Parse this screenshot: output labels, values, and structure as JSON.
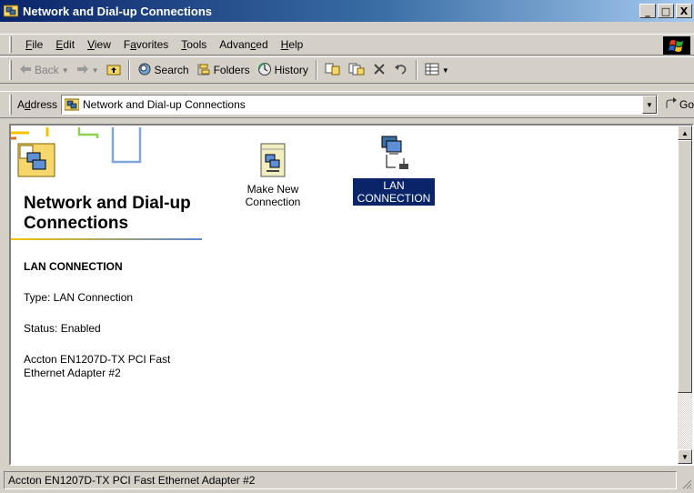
{
  "window": {
    "title": "Network and Dial-up Connections",
    "controls": {
      "minimize": "_",
      "maximize": "□",
      "close": "X"
    }
  },
  "menu": {
    "items": [
      {
        "underline": "F",
        "rest": "ile"
      },
      {
        "underline": "E",
        "rest": "dit"
      },
      {
        "underline": "V",
        "rest": "iew"
      },
      {
        "pre": "F",
        "underline": "a",
        "rest": "vorites"
      },
      {
        "underline": "T",
        "rest": "ools"
      },
      {
        "pre": "Advan",
        "underline": "c",
        "rest": "ed"
      },
      {
        "underline": "H",
        "rest": "elp"
      }
    ]
  },
  "toolbar": {
    "back": "Back",
    "search": "Search",
    "folders": "Folders",
    "history": "History"
  },
  "address": {
    "label_pre": "A",
    "label_ul": "d",
    "label_rest": "dress",
    "value": "Network and Dial-up Connections",
    "go": "Go"
  },
  "left_pane": {
    "title": "Network and Dial-up Connections",
    "selected_name": "LAN CONNECTION",
    "type": "Type: LAN Connection",
    "status": "Status: Enabled",
    "adapter": "Accton EN1207D-TX PCI Fast Ethernet Adapter #2"
  },
  "icons": [
    {
      "label": "Make New Connection",
      "selected": false
    },
    {
      "label": "LAN CONNECTION",
      "selected": true
    }
  ],
  "statusbar": {
    "text": "Accton EN1207D-TX PCI Fast Ethernet Adapter #2"
  },
  "colors": {
    "title_bar": "#0a246a",
    "selection": "#0a246a",
    "face": "#d4d0c8"
  }
}
